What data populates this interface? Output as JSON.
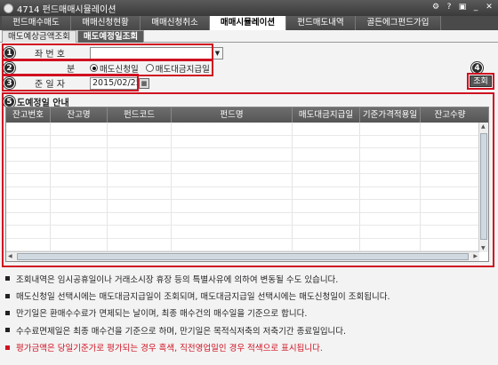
{
  "window": {
    "title": "4714 펀드매매시뮬레이션",
    "controls": [
      "⚙",
      "?",
      "▣",
      "_",
      "✕"
    ]
  },
  "main_tabs": [
    "펀드매수매도",
    "매매신청현황",
    "매매신청취소",
    "매매시뮬레이션",
    "펀드매도내역",
    "골든에그펀드가입"
  ],
  "sub_tabs": [
    "매도예상금액조회",
    "매도예정일조회"
  ],
  "form": {
    "account_label": "좌 번 호",
    "account_value": "",
    "division_label": "분",
    "radio_options": [
      "매도신청일",
      "매도대금지급일"
    ],
    "selected_radio": "매도신청일",
    "date_label": "준 일 자",
    "date_value": "2015/02/25",
    "query_label": "조회"
  },
  "badges": [
    "1",
    "2",
    "3",
    "4",
    "5"
  ],
  "section_title": "도예정일 안내",
  "grid": {
    "columns": [
      "잔고번호",
      "잔고명",
      "펀드코드",
      "펀드명",
      "매도대금지급일",
      "기준가격적용일",
      "잔고수량"
    ],
    "rows": []
  },
  "notes": [
    {
      "text": "조회내역은 임시공휴일이나 거래소시장 휴장 등의 특별사유에 의하여 변동될 수도 있습니다.",
      "color": "#222222"
    },
    {
      "text": "매도신청일 선택시에는 매도대금지급일이 조회되며, 매도대금지급일 선택시에는 매도신청일이 조회됩니다.",
      "color": "#222222"
    },
    {
      "text": "만기일은 환매수수료가 면제되는 날이며, 최종 매수건의 매수일을 기준으로 합니다.",
      "color": "#222222"
    },
    {
      "text": "수수료면제일은 최종 매수건을 기준으로 하며, 만기일은 목적식저축의 저축기간 종료일입니다.",
      "color": "#222222"
    },
    {
      "text": "평가금액은 당일기준가로 평가되는 경우 흑색, 직전영업일인 경우 적색으로 표시됩니다.",
      "color": "#d01020"
    }
  ],
  "colors": {
    "highlight": "#d01020",
    "header": "#5a5a5a"
  }
}
